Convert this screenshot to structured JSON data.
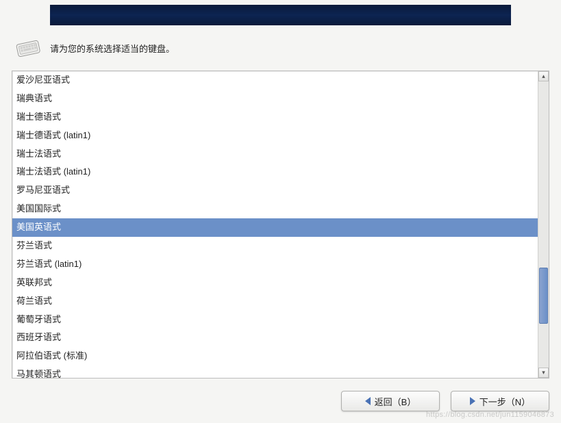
{
  "prompt": "请为您的系统选择适当的键盘。",
  "keyboard_list": {
    "selected_index": 8,
    "items": [
      "爱沙尼亚语式",
      "瑞典语式",
      "瑞士德语式",
      "瑞士德语式 (latin1)",
      "瑞士法语式",
      "瑞士法语式 (latin1)",
      "罗马尼亚语式",
      "美国国际式",
      "美国英语式",
      "芬兰语式",
      "芬兰语式 (latin1)",
      "英联邦式",
      "荷兰语式",
      "葡萄牙语式",
      "西班牙语式",
      "阿拉伯语式 (标准)",
      "马其顿语式"
    ]
  },
  "buttons": {
    "back": "返回（B）",
    "next": "下一步（N）"
  },
  "watermark": "https://blog.csdn.net/jun1159046873"
}
